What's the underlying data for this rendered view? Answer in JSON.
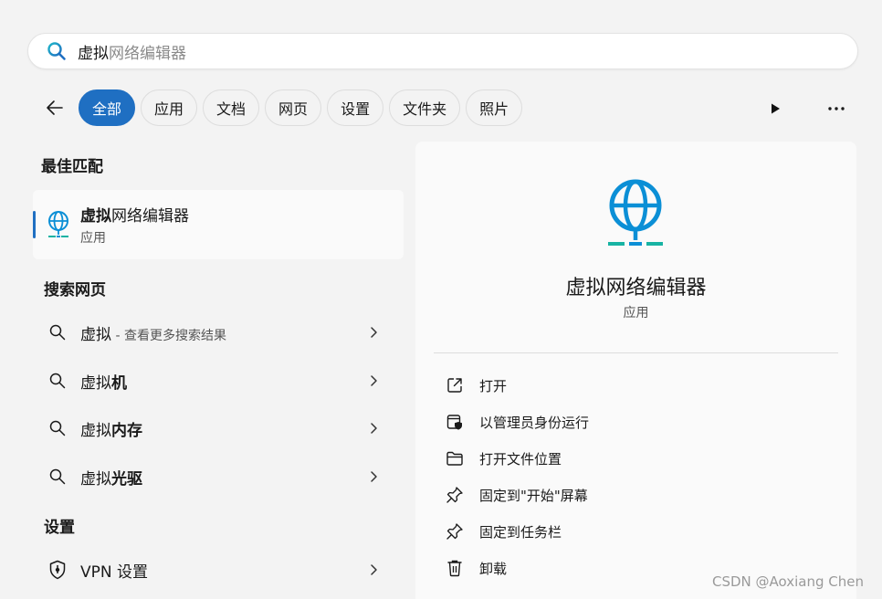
{
  "search": {
    "typed": "虚拟",
    "suggestion": "网络编辑器"
  },
  "tabs": [
    {
      "label": "全部",
      "active": true
    },
    {
      "label": "应用",
      "active": false
    },
    {
      "label": "文档",
      "active": false
    },
    {
      "label": "网页",
      "active": false
    },
    {
      "label": "设置",
      "active": false
    },
    {
      "label": "文件夹",
      "active": false
    },
    {
      "label": "照片",
      "active": false
    }
  ],
  "best_match": {
    "heading": "最佳匹配",
    "title_bold": "虚拟",
    "title_rest": "网络编辑器",
    "subtitle": "应用",
    "icon": "globe-network-icon"
  },
  "web_search": {
    "heading": "搜索网页",
    "items": [
      {
        "prefix": "虚拟",
        "bold": "",
        "hint": " - 查看更多搜索结果"
      },
      {
        "prefix": "虚拟",
        "bold": "机",
        "hint": ""
      },
      {
        "prefix": "虚拟",
        "bold": "内存",
        "hint": ""
      },
      {
        "prefix": "虚拟",
        "bold": "光驱",
        "hint": ""
      }
    ]
  },
  "settings": {
    "heading": "设置",
    "items": [
      {
        "label": "VPN 设置",
        "icon": "shield-icon"
      }
    ]
  },
  "detail": {
    "app_name": "虚拟网络编辑器",
    "app_type": "应用",
    "actions": [
      {
        "label": "打开",
        "icon": "open-external-icon"
      },
      {
        "label": "以管理员身份运行",
        "icon": "admin-shield-icon"
      },
      {
        "label": "打开文件位置",
        "icon": "folder-icon"
      },
      {
        "label": "固定到\"开始\"屏幕",
        "icon": "pin-icon"
      },
      {
        "label": "固定到任务栏",
        "icon": "pin-icon"
      },
      {
        "label": "卸载",
        "icon": "trash-icon"
      }
    ]
  },
  "watermark": "CSDN @Aoxiang Chen",
  "colors": {
    "accent": "#1f6fc2",
    "globe_blue": "#0b8fd6",
    "globe_base": "#17b3a3"
  }
}
